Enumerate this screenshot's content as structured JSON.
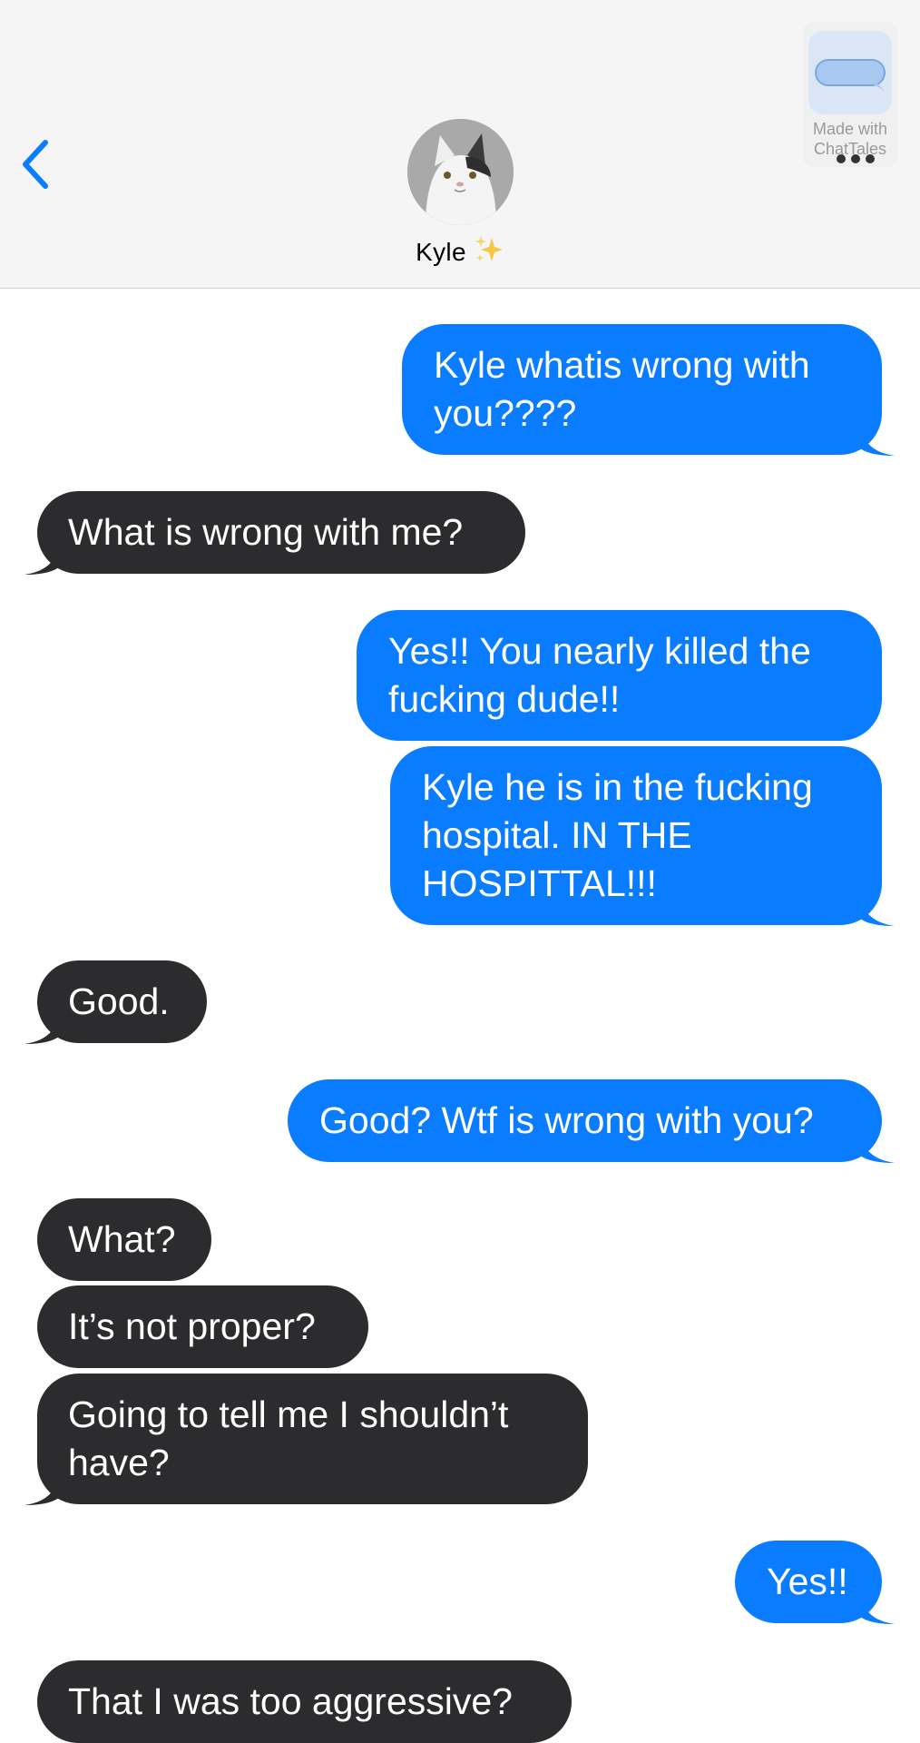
{
  "header": {
    "contact_name": "Kyle",
    "name_emoji": "sparkles-icon",
    "back_icon": "chevron-left-icon",
    "more_icon": "ellipsis-icon",
    "accent_color": "#0a7cff"
  },
  "watermark": {
    "line1": "Made with",
    "line2": "ChatTales"
  },
  "messages": [
    {
      "from": "me",
      "text_lines": [
        "Kyle whatis wrong with",
        "you????"
      ]
    },
    {
      "from": "them",
      "text_lines": [
        "What is wrong with me?"
      ]
    },
    {
      "from": "me",
      "text_lines": [
        "Yes!! You nearly killed the",
        "fucking dude!!"
      ]
    },
    {
      "from": "me",
      "text_lines": [
        "Kyle he is in the fucking",
        "hospital.  IN THE",
        "HOSPITTAL!!!"
      ]
    },
    {
      "from": "them",
      "text_lines": [
        "Good."
      ]
    },
    {
      "from": "me",
      "text_lines": [
        "Good? Wtf is wrong with you?"
      ]
    },
    {
      "from": "them",
      "text_lines": [
        "What?"
      ]
    },
    {
      "from": "them",
      "text_lines": [
        "It’s not proper?"
      ]
    },
    {
      "from": "them",
      "text_lines": [
        "Going to tell me I shouldn’t",
        "have?"
      ]
    },
    {
      "from": "me",
      "text_lines": [
        "Yes!!"
      ]
    },
    {
      "from": "them",
      "text_lines": [
        "That I was too aggressive?"
      ]
    }
  ],
  "colors": {
    "sent_bubble": "#0a7cff",
    "received_bubble": "#2c2c2e",
    "header_bg": "#f5f5f5"
  }
}
